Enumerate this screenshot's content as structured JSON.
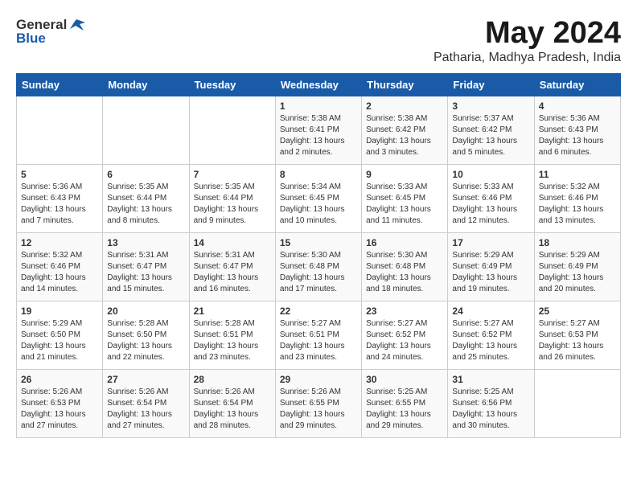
{
  "header": {
    "logo_general": "General",
    "logo_blue": "Blue",
    "title": "May 2024",
    "subtitle": "Patharia, Madhya Pradesh, India"
  },
  "days_of_week": [
    "Sunday",
    "Monday",
    "Tuesday",
    "Wednesday",
    "Thursday",
    "Friday",
    "Saturday"
  ],
  "weeks": [
    [
      {
        "day": "",
        "content": ""
      },
      {
        "day": "",
        "content": ""
      },
      {
        "day": "",
        "content": ""
      },
      {
        "day": "1",
        "content": "Sunrise: 5:38 AM\nSunset: 6:41 PM\nDaylight: 13 hours\nand 2 minutes."
      },
      {
        "day": "2",
        "content": "Sunrise: 5:38 AM\nSunset: 6:42 PM\nDaylight: 13 hours\nand 3 minutes."
      },
      {
        "day": "3",
        "content": "Sunrise: 5:37 AM\nSunset: 6:42 PM\nDaylight: 13 hours\nand 5 minutes."
      },
      {
        "day": "4",
        "content": "Sunrise: 5:36 AM\nSunset: 6:43 PM\nDaylight: 13 hours\nand 6 minutes."
      }
    ],
    [
      {
        "day": "5",
        "content": "Sunrise: 5:36 AM\nSunset: 6:43 PM\nDaylight: 13 hours\nand 7 minutes."
      },
      {
        "day": "6",
        "content": "Sunrise: 5:35 AM\nSunset: 6:44 PM\nDaylight: 13 hours\nand 8 minutes."
      },
      {
        "day": "7",
        "content": "Sunrise: 5:35 AM\nSunset: 6:44 PM\nDaylight: 13 hours\nand 9 minutes."
      },
      {
        "day": "8",
        "content": "Sunrise: 5:34 AM\nSunset: 6:45 PM\nDaylight: 13 hours\nand 10 minutes."
      },
      {
        "day": "9",
        "content": "Sunrise: 5:33 AM\nSunset: 6:45 PM\nDaylight: 13 hours\nand 11 minutes."
      },
      {
        "day": "10",
        "content": "Sunrise: 5:33 AM\nSunset: 6:46 PM\nDaylight: 13 hours\nand 12 minutes."
      },
      {
        "day": "11",
        "content": "Sunrise: 5:32 AM\nSunset: 6:46 PM\nDaylight: 13 hours\nand 13 minutes."
      }
    ],
    [
      {
        "day": "12",
        "content": "Sunrise: 5:32 AM\nSunset: 6:46 PM\nDaylight: 13 hours\nand 14 minutes."
      },
      {
        "day": "13",
        "content": "Sunrise: 5:31 AM\nSunset: 6:47 PM\nDaylight: 13 hours\nand 15 minutes."
      },
      {
        "day": "14",
        "content": "Sunrise: 5:31 AM\nSunset: 6:47 PM\nDaylight: 13 hours\nand 16 minutes."
      },
      {
        "day": "15",
        "content": "Sunrise: 5:30 AM\nSunset: 6:48 PM\nDaylight: 13 hours\nand 17 minutes."
      },
      {
        "day": "16",
        "content": "Sunrise: 5:30 AM\nSunset: 6:48 PM\nDaylight: 13 hours\nand 18 minutes."
      },
      {
        "day": "17",
        "content": "Sunrise: 5:29 AM\nSunset: 6:49 PM\nDaylight: 13 hours\nand 19 minutes."
      },
      {
        "day": "18",
        "content": "Sunrise: 5:29 AM\nSunset: 6:49 PM\nDaylight: 13 hours\nand 20 minutes."
      }
    ],
    [
      {
        "day": "19",
        "content": "Sunrise: 5:29 AM\nSunset: 6:50 PM\nDaylight: 13 hours\nand 21 minutes."
      },
      {
        "day": "20",
        "content": "Sunrise: 5:28 AM\nSunset: 6:50 PM\nDaylight: 13 hours\nand 22 minutes."
      },
      {
        "day": "21",
        "content": "Sunrise: 5:28 AM\nSunset: 6:51 PM\nDaylight: 13 hours\nand 23 minutes."
      },
      {
        "day": "22",
        "content": "Sunrise: 5:27 AM\nSunset: 6:51 PM\nDaylight: 13 hours\nand 23 minutes."
      },
      {
        "day": "23",
        "content": "Sunrise: 5:27 AM\nSunset: 6:52 PM\nDaylight: 13 hours\nand 24 minutes."
      },
      {
        "day": "24",
        "content": "Sunrise: 5:27 AM\nSunset: 6:52 PM\nDaylight: 13 hours\nand 25 minutes."
      },
      {
        "day": "25",
        "content": "Sunrise: 5:27 AM\nSunset: 6:53 PM\nDaylight: 13 hours\nand 26 minutes."
      }
    ],
    [
      {
        "day": "26",
        "content": "Sunrise: 5:26 AM\nSunset: 6:53 PM\nDaylight: 13 hours\nand 27 minutes."
      },
      {
        "day": "27",
        "content": "Sunrise: 5:26 AM\nSunset: 6:54 PM\nDaylight: 13 hours\nand 27 minutes."
      },
      {
        "day": "28",
        "content": "Sunrise: 5:26 AM\nSunset: 6:54 PM\nDaylight: 13 hours\nand 28 minutes."
      },
      {
        "day": "29",
        "content": "Sunrise: 5:26 AM\nSunset: 6:55 PM\nDaylight: 13 hours\nand 29 minutes."
      },
      {
        "day": "30",
        "content": "Sunrise: 5:25 AM\nSunset: 6:55 PM\nDaylight: 13 hours\nand 29 minutes."
      },
      {
        "day": "31",
        "content": "Sunrise: 5:25 AM\nSunset: 6:56 PM\nDaylight: 13 hours\nand 30 minutes."
      },
      {
        "day": "",
        "content": ""
      }
    ]
  ]
}
